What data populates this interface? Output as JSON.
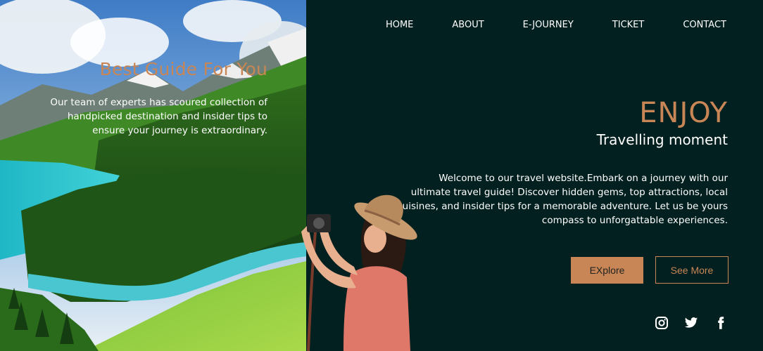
{
  "nav": {
    "items": [
      "HOME",
      "ABOUT",
      "E-JOURNEY",
      "TICKET",
      "CONTACT"
    ]
  },
  "left": {
    "title": "Best Guide For You",
    "text": "Our team of experts has scoured collection of handpicked destination and insider tips to ensure your journey is extraordinary."
  },
  "hero": {
    "headline": "ENJOY",
    "subtitle": "Travelling moment",
    "description": "Welcome to our travel website.Embark on a journey with our ultimate travel guide! Discover hidden gems, top attractions, local cuisines, and insider tips for a memorable adventure. Let us be yours compass to unforgattable experiences."
  },
  "buttons": {
    "explore": "EXplore",
    "see_more": "See More"
  },
  "socials": [
    "instagram-icon",
    "twitter-icon",
    "facebook-icon"
  ],
  "colors": {
    "background": "#02201f",
    "accent": "#c88656",
    "text": "#ffffff"
  }
}
